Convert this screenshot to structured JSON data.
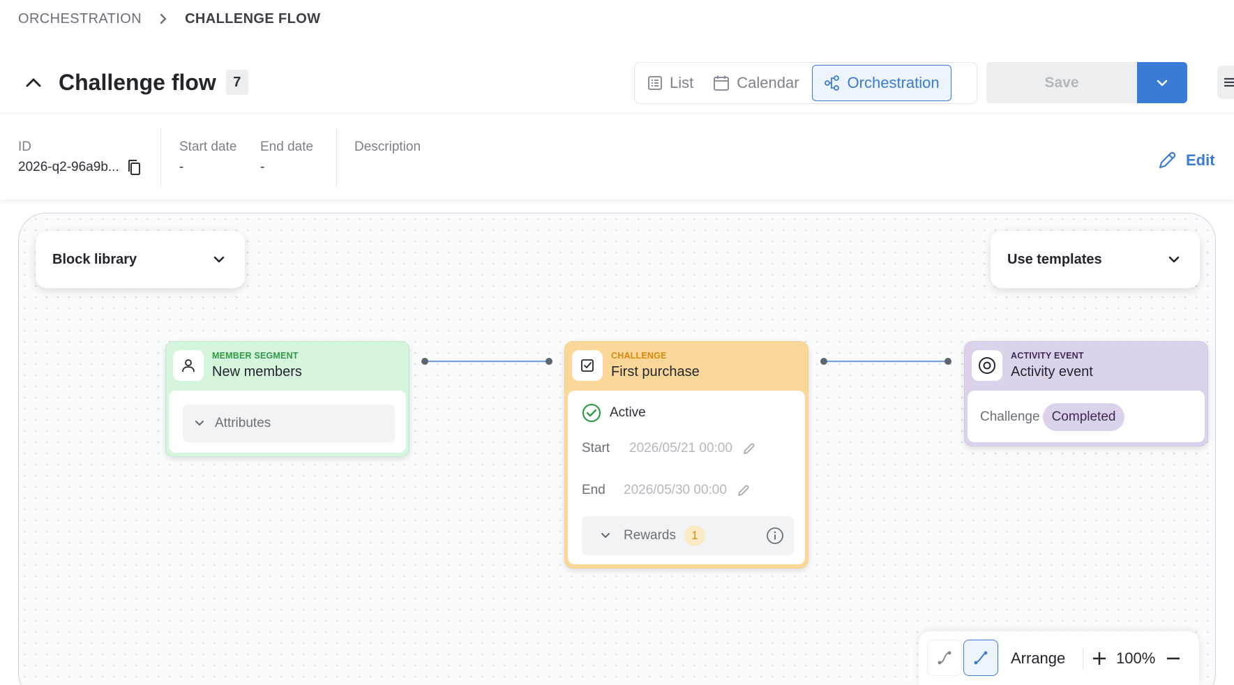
{
  "breadcrumb": {
    "items": [
      "ORCHESTRATION",
      "CHALLENGE FLOW"
    ]
  },
  "header": {
    "title": "Challenge flow",
    "count": "7"
  },
  "view_switch": {
    "options": [
      "List",
      "Calendar",
      "Orchestration"
    ],
    "active": "Orchestration"
  },
  "actions": {
    "save_label": "Save"
  },
  "info": {
    "id_label": "ID",
    "id_value": "2026-q2-96a9b...",
    "start_label": "Start date",
    "start_value": "-",
    "end_label": "End date",
    "end_value": "-",
    "description_label": "Description",
    "edit_label": "Edit"
  },
  "canvas": {
    "block_library_label": "Block library",
    "templates_label": "Use templates",
    "blocks": {
      "segment": {
        "type": "MEMBER SEGMENT",
        "title": "New members",
        "attributes_label": "Attributes"
      },
      "challenge": {
        "type": "CHALLENGE",
        "title": "First purchase",
        "status": "Active",
        "start_label": "Start",
        "start_value": "2026/05/21 00:00",
        "end_label": "End",
        "end_value": "2026/05/30 00:00",
        "rewards_label": "Rewards",
        "rewards_count": "1"
      },
      "activity": {
        "type": "ACTIVITY EVENT",
        "title": "Activity event",
        "condition_label": "Challenge",
        "condition_value": "Completed"
      }
    }
  },
  "toolbar": {
    "arrange_label": "Arrange",
    "zoom": "100%"
  },
  "colors": {
    "accent": "#3a7bd5",
    "segment_head": "#d5f5dc",
    "segment_type": "#2f9a45",
    "challenge_head": "#fbd89a",
    "challenge_type": "#d48a0a",
    "activity_head": "#ddd2ec",
    "activity_type": "#3a2c52",
    "status_active": "#2f9a45"
  },
  "icons": {
    "breadcrumb_separator": "chevron-right-icon",
    "collapse": "chevron-up-icon",
    "list": "list-icon",
    "calendar": "calendar-icon",
    "orchestration": "flow-nodes-icon",
    "save_menu": "chevron-down-icon",
    "side_menu": "menu-icon",
    "copy": "copy-icon",
    "edit": "pencil-icon",
    "segment": "person-icon",
    "challenge": "checkbox-icon",
    "activity": "target-icon",
    "status": "check-circle-icon",
    "rewards_info": "info-icon",
    "route_curved": "route-curved-icon",
    "route_straight": "route-straight-icon",
    "zoom_in": "plus-icon",
    "zoom_out": "minus-icon"
  }
}
